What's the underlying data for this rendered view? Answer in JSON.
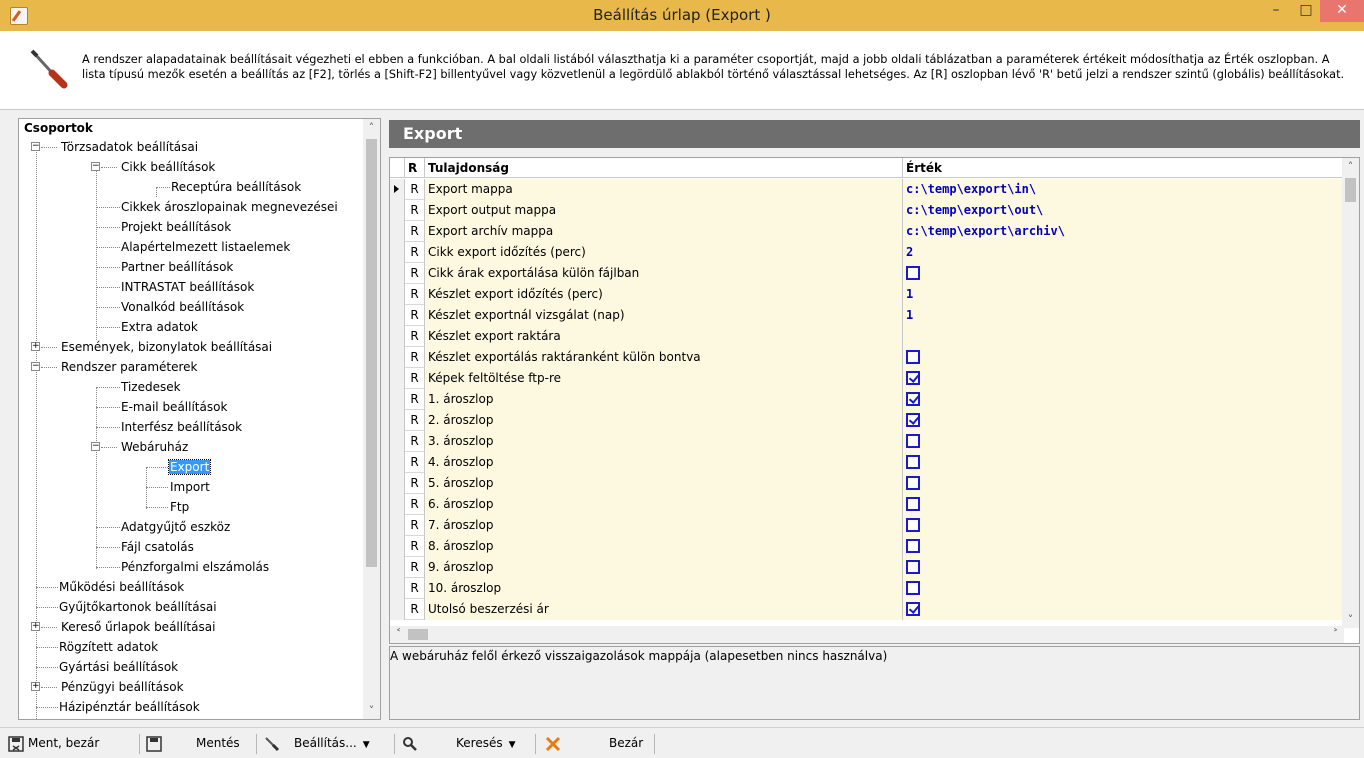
{
  "window": {
    "title": "Beállítás úrlap (Export )",
    "min_icon": "minimize-icon",
    "max_icon": "maximize-icon",
    "close_icon": "close-icon"
  },
  "header": {
    "icon": "screwdriver-icon",
    "description": "A rendszer alapadatainak beállításait végezheti el ebben a funkcióban. A bal oldali listából választhatja ki a paraméter csoportját, majd a jobb oldali táblázatban a paraméterek értékeit módosíthatja az Érték oszlopban. A lista típusú mezők esetén a beállítás az [F2], törlés a [Shift-F2] billentyűvel vagy közvetlenül a legördülő ablakból történő választással lehetséges. Az [R] oszlopban lévő 'R' betű jelzi a rendszer szintű (globális) beállításokat."
  },
  "tree": {
    "header": "Csoportok",
    "items": [
      {
        "label": "Törzsadatok beállításai",
        "expander": "−"
      },
      {
        "label": "Cikk beállítások",
        "expander": "−"
      },
      {
        "label": "Receptúra beállítások"
      },
      {
        "label": "Cikkek ároszlopainak megnevezései"
      },
      {
        "label": "Projekt beállítások"
      },
      {
        "label": "Alapértelmezett listaelemek"
      },
      {
        "label": "Partner beállítások"
      },
      {
        "label": "INTRASTAT beállítások"
      },
      {
        "label": "Vonalkód beállítások"
      },
      {
        "label": "Extra adatok"
      },
      {
        "label": "Események, bizonylatok beállításai",
        "expander": "+"
      },
      {
        "label": "Rendszer paraméterek",
        "expander": "−"
      },
      {
        "label": "Tizedesek"
      },
      {
        "label": "E-mail beállítások"
      },
      {
        "label": "Interfész beállítások"
      },
      {
        "label": "Webáruház",
        "expander": "−"
      },
      {
        "label": "Export"
      },
      {
        "label": "Import"
      },
      {
        "label": "Ftp"
      },
      {
        "label": "Adatgyűjtő eszköz"
      },
      {
        "label": "Fájl csatolás"
      },
      {
        "label": "Pénzforgalmi elszámolás"
      },
      {
        "label": "Működési beállítások"
      },
      {
        "label": "Gyűjtőkartonok beállításai"
      },
      {
        "label": "Kereső űrlapok beállításai",
        "expander": "+"
      },
      {
        "label": "Rögzített adatok"
      },
      {
        "label": "Gyártási beállítások"
      },
      {
        "label": "Pénzügyi beállítások",
        "expander": "+"
      },
      {
        "label": "Házipénztár beállítások"
      }
    ]
  },
  "panel": {
    "title": "Export",
    "columns": {
      "r": "R",
      "property": "Tulajdonság",
      "value": "Érték"
    },
    "rows": [
      {
        "r": "R",
        "property": "Export mappa",
        "value": "c:\\temp\\export\\in\\"
      },
      {
        "r": "R",
        "property": "Export output mappa",
        "value": "c:\\temp\\export\\out\\"
      },
      {
        "r": "R",
        "property": "Export archív mappa",
        "value": "c:\\temp\\export\\archiv\\"
      },
      {
        "r": "R",
        "property": "Cikk export időzítés (perc)",
        "value": "2"
      },
      {
        "r": "R",
        "property": "Cikk árak exportálása külön fájlban",
        "checkbox": false
      },
      {
        "r": "R",
        "property": "Készlet export időzítés (perc)",
        "value": "1"
      },
      {
        "r": "R",
        "property": "Készlet exportnál vizsgálat (nap)",
        "value": "1"
      },
      {
        "r": "R",
        "property": "Készlet export raktára",
        "value": ""
      },
      {
        "r": "R",
        "property": "Készlet exportálás raktáranként külön bontva",
        "checkbox": false
      },
      {
        "r": "R",
        "property": "Képek feltöltése ftp-re",
        "checkbox": true
      },
      {
        "r": "R",
        "property": "1. ároszlop",
        "checkbox": true
      },
      {
        "r": "R",
        "property": "2. ároszlop",
        "checkbox": true
      },
      {
        "r": "R",
        "property": "3. ároszlop",
        "checkbox": false
      },
      {
        "r": "R",
        "property": "4. ároszlop",
        "checkbox": false
      },
      {
        "r": "R",
        "property": "5. ároszlop",
        "checkbox": false
      },
      {
        "r": "R",
        "property": "6. ároszlop",
        "checkbox": false
      },
      {
        "r": "R",
        "property": "7. ároszlop",
        "checkbox": false
      },
      {
        "r": "R",
        "property": "8. ároszlop",
        "checkbox": false
      },
      {
        "r": "R",
        "property": "9. ároszlop",
        "checkbox": false
      },
      {
        "r": "R",
        "property": "10. ároszlop",
        "checkbox": false
      },
      {
        "r": "R",
        "property": "Utolsó beszerzési ár",
        "checkbox": true
      }
    ],
    "description": "A webáruház felől érkező visszaigazolások mappája (alapesetben nincs használva)"
  },
  "toolbar": {
    "save_close": "Ment, bezár",
    "save": "Mentés",
    "settings": "Beállítás...",
    "search": "Keresés",
    "close": "Bezár"
  },
  "colors": {
    "titlebar": "#e8b84a",
    "close_button": "#e8766f",
    "panel_header": "#6e6e6e",
    "cell_bg": "#fdf8e0",
    "value_text": "#0000c0",
    "selected": "#3399ff"
  }
}
